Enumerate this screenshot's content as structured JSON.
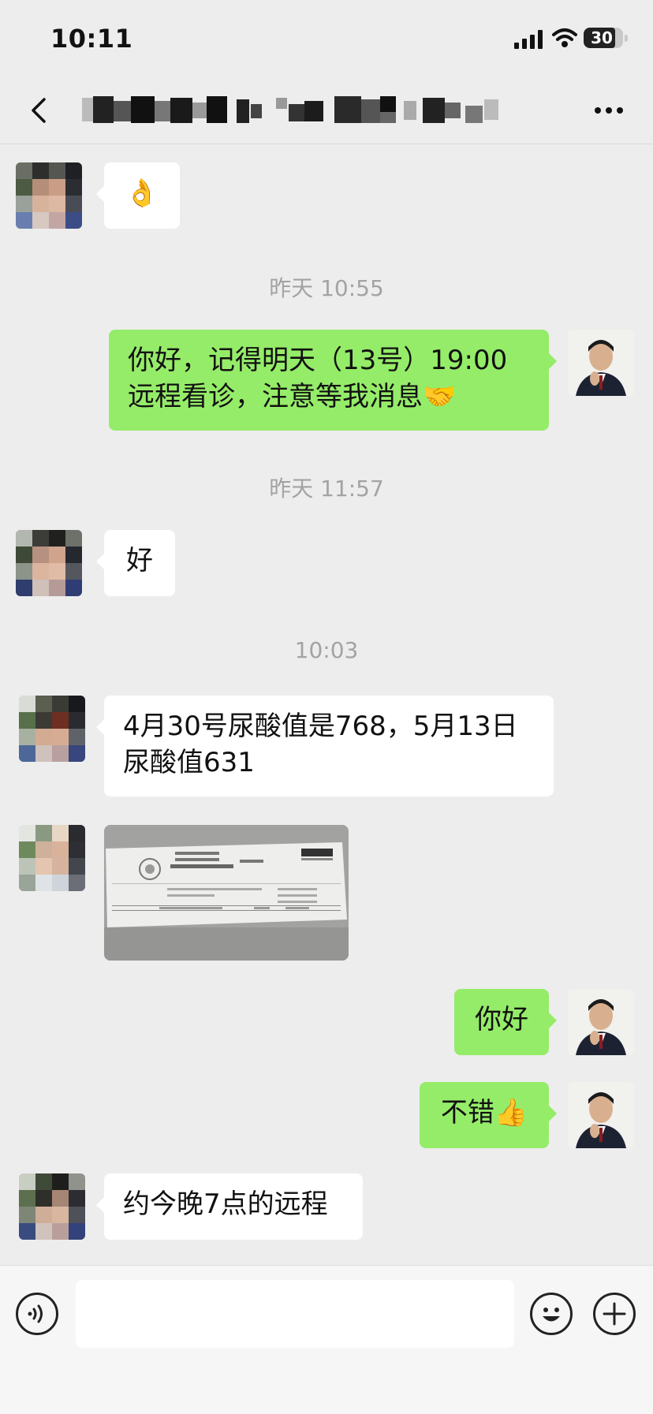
{
  "status_bar": {
    "time": "10:11",
    "battery": "30"
  },
  "nav": {
    "back_icon": "chevron-left-icon",
    "title": "",
    "more_icon": "more-horizontal-icon"
  },
  "timestamps": [
    "昨天 10:55",
    "昨天 11:57",
    "10:03"
  ],
  "messages": [
    {
      "side": "in",
      "type": "emoji",
      "text": "👌"
    },
    {
      "side": "out",
      "type": "text",
      "text": "你好，记得明天（13号）19:00远程看诊，注意等我消息🤝"
    },
    {
      "side": "in",
      "type": "text",
      "text": "好"
    },
    {
      "side": "in",
      "type": "text",
      "text": "4月30号尿酸值是768，5月13日尿酸值631"
    },
    {
      "side": "in",
      "type": "image",
      "text": ""
    },
    {
      "side": "out",
      "type": "text",
      "text": "你好"
    },
    {
      "side": "out",
      "type": "text",
      "text": "不错👍"
    },
    {
      "side": "in",
      "type": "text",
      "text": "约今晚7点的远程"
    }
  ],
  "input_bar": {
    "voice_icon": "voice-icon",
    "emoji_icon": "emoji-icon",
    "plus_icon": "plus-icon",
    "placeholder": ""
  },
  "colors": {
    "outgoing_bubble": "#95ec69",
    "incoming_bubble": "#ffffff",
    "background": "#ededed"
  }
}
